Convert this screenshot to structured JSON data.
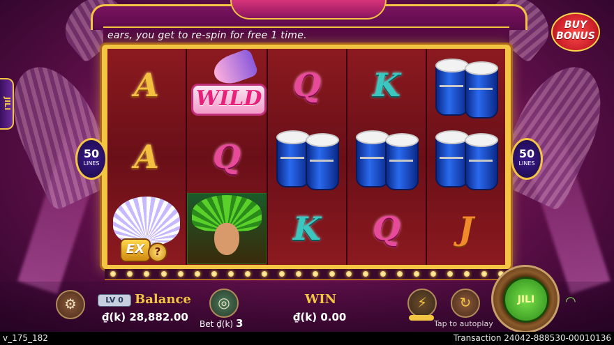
{
  "marquee": {
    "text": "ears, you get to re-spin for free 1 time."
  },
  "buy_bonus": {
    "line1": "BUY",
    "line2": "BONUS"
  },
  "brand_tab": "JILI",
  "lines": {
    "left_count": "50",
    "right_count": "50",
    "label": "LINES"
  },
  "reels": [
    [
      "A",
      "A",
      "dancer-white"
    ],
    [
      "WILD",
      "Q",
      "dancer-green"
    ],
    [
      "Q",
      "drums",
      "K"
    ],
    [
      "K",
      "drums",
      "Q"
    ],
    [
      "drums",
      "drums",
      "J"
    ]
  ],
  "wild_text": "WILD",
  "ex_badge": {
    "ex": "EX",
    "help": "?"
  },
  "level": "LV 0",
  "balance": {
    "label": "Balance",
    "value": "₫(k) 28,882.00"
  },
  "bet": {
    "label": "Bet",
    "currency": "₫(k)",
    "value": "3"
  },
  "win": {
    "label": "WIN",
    "value": "₫(k) 0.00"
  },
  "autoplay_hint": "Tap to autoplay",
  "spin_button": "JILI",
  "status_bar": {
    "version": "v_175_182",
    "transaction": "Transaction 24042-888530-00010136"
  },
  "colors": {
    "frame_gold": "#f4c542",
    "reel_bg": "#8b1a1f",
    "accent_pink": "#b0317a"
  }
}
